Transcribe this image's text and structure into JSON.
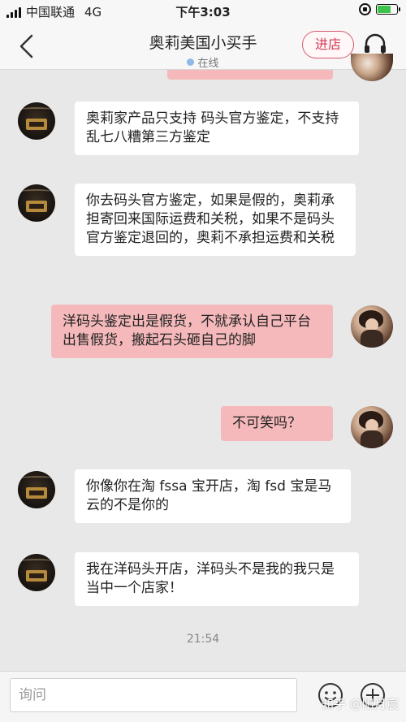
{
  "status_bar": {
    "carrier": "中国联通",
    "network": "4G",
    "time": "下午3:03"
  },
  "header": {
    "title": "奥莉美国小买手",
    "status": "在线",
    "store_button": "进店"
  },
  "messages": [
    {
      "side": "in",
      "text": "奥莉家产品只支持 码头官方鉴定，不支持 乱七八糟第三方鉴定"
    },
    {
      "side": "in",
      "text": "你去码头官方鉴定，如果是假的，奥莉承担寄回来国际运费和关税，如果不是码头官方鉴定退回的，奥莉不承担运费和关税"
    },
    {
      "side": "out",
      "text": "洋码头鉴定出是假货，不就承认自己平台出售假货，搬起石头砸自己的脚"
    },
    {
      "side": "out",
      "text": "不可笑吗？"
    },
    {
      "side": "in",
      "text": "你像你在淘 fssa 宝开店，淘 fsd 宝是马云的不是你的"
    },
    {
      "side": "in",
      "text": "我在洋码头开店，洋码头不是我的我只是当中一个店家！"
    }
  ],
  "timestamp": "21:54",
  "input": {
    "placeholder": "询问"
  },
  "watermark": "知乎 @阳月宸",
  "colors": {
    "outgoing_bubble": "#f5b9bb",
    "incoming_bubble": "#ffffff",
    "accent": "#d43a55",
    "background": "#e8e8e8"
  }
}
